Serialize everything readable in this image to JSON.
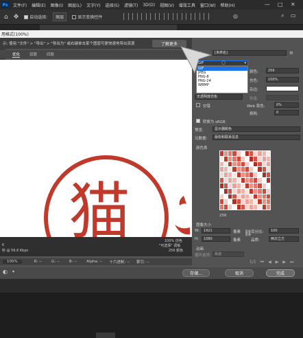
{
  "menubar": {
    "app_icon": "Ps",
    "items": [
      "文件(F)",
      "编辑(E)",
      "图像(I)",
      "图层(L)",
      "文字(Y)",
      "选择(S)",
      "滤镜(T)",
      "3D(D)",
      "视图(V)",
      "增效工具",
      "窗口(W)",
      "帮助(H)"
    ],
    "window_controls": [
      "—",
      "□",
      "✕"
    ]
  },
  "optionsbar": {
    "auto_select_label": "自动选择:",
    "auto_select_value": "图层",
    "show_transform_label": "显示变换控件"
  },
  "dialog": {
    "title": "用格式(100%)",
    "info_text": "示: 使用 \"文件\" > \"导出\" > \"导出为\" 或右键单击某个图层可更快速地导出资源",
    "learn_more": "了解更多",
    "view_tabs": [
      "优化",
      "双联",
      "四联"
    ],
    "active_tab": "优化"
  },
  "preview": {
    "seal_char": "猫",
    "info_left": [
      "K",
      "秒 @ 56.6 Kbps"
    ],
    "info_right": [
      "100% 仿色",
      "\"可选择\" 调板",
      "256 颜色"
    ],
    "zoom": "100%",
    "r_label": "R: --",
    "g_label": "G: --",
    "b_label": "B: --",
    "alpha_label": "Alpha: --",
    "hex_label": "十六进制: --",
    "index_label": "索引: --"
  },
  "panel": {
    "preset_label": "预设:",
    "preset_value": "[未命名]",
    "format_value": "GIF",
    "dropdown_options": [
      "GIF",
      "JPEG",
      "PNG-8",
      "PNG-24",
      "WBMP"
    ],
    "dropdown_selected": "GIF",
    "colors_label": "颜色:",
    "colors_value": "256",
    "dither_label": "仿色:",
    "dither_value": "100%",
    "matte_label": "杂边:",
    "amount_label": "数量:",
    "web_snap_label": "Web 靠色:",
    "web_snap_value": "0%",
    "lossy_label": "损耗:",
    "lossy_value": "0",
    "transparency_dither_value": "无透明度仿色",
    "interlaced_label": "交错",
    "convert_srgb_label": "转换为 sRGB",
    "preview_label": "预览:",
    "preview_value": "显示器颜色",
    "metadata_label": "元数据:",
    "metadata_value": "版权和联系信息",
    "color_table_label": "颜色表",
    "color_count": "256",
    "image_size_label": "图像大小",
    "width_label": "W:",
    "width_value": "1921",
    "height_label": "H:",
    "height_value": "1080",
    "unit_px": "像素",
    "percent_label": "百分比:",
    "percent_value": "100",
    "quality_label": "品质:",
    "quality_value": "两次立方",
    "animation_label": "动画",
    "loop_label": "循环选项:",
    "loop_value": "永远",
    "frame_counter": "1/1"
  },
  "buttons": {
    "save": "存储...",
    "cancel": "取消",
    "done": "完成"
  },
  "colors": {
    "accent": "#1a73e8",
    "seal_red": "#c0392b"
  }
}
